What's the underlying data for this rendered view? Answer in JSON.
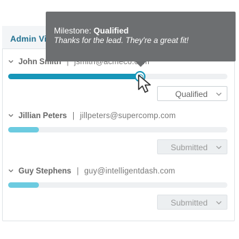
{
  "panel": {
    "tab_title": "Admin Vi"
  },
  "tooltip": {
    "label": "Milestone:",
    "milestone": "Qualified",
    "message": "Thanks for the lead. They're a great fit!"
  },
  "leads": [
    {
      "name": "John Smith",
      "email": "jsmith@acmeco.com",
      "progress": 0.61,
      "status": "Qualified",
      "status_enabled": true
    },
    {
      "name": "Jillian Peters",
      "email": "jillpeters@supercomp.com",
      "progress": 0.14,
      "status": "Submitted",
      "status_enabled": false
    },
    {
      "name": "Guy Stephens",
      "email": "guy@intelligentdash.com",
      "progress": 0.14,
      "status": "Submitted",
      "status_enabled": false
    }
  ],
  "separator": "|",
  "colors": {
    "active": "#1796b9",
    "pending": "#6ccbe0",
    "tooltip_bg": "#6d6f71",
    "tab_title": "#1f6f8f"
  },
  "icons": {
    "chevron": "chevron-down-icon",
    "cursor": "pointer-cursor-icon",
    "handle": "slider-handle"
  }
}
